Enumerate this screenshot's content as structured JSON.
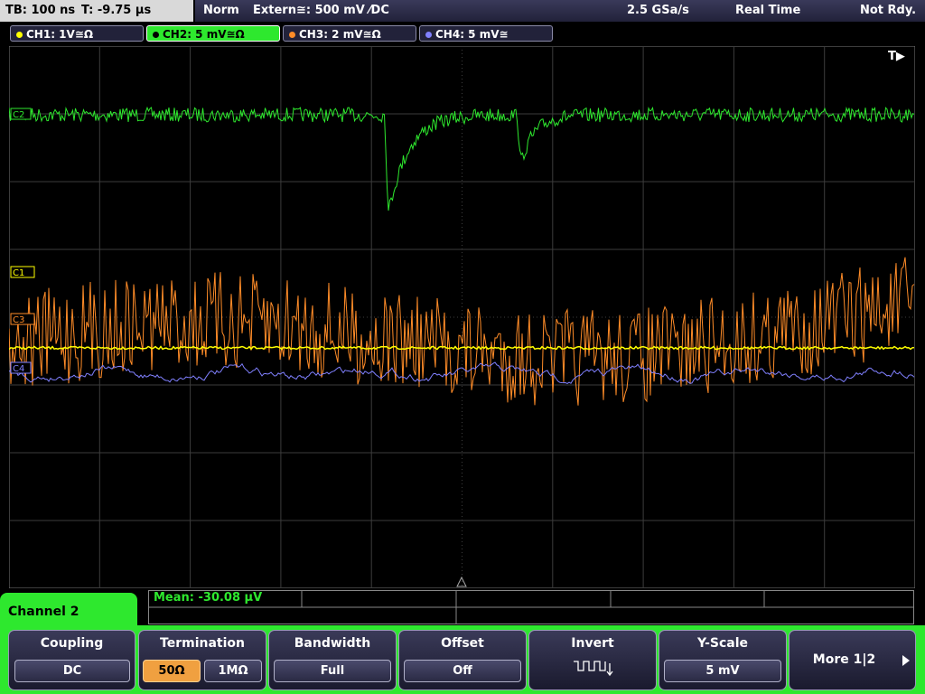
{
  "top": {
    "timebase": "TB: 100 ns",
    "trigger_time": "T: -9.75 µs",
    "mode": "Norm",
    "trigger_source": "Extern≅: 500 mV ⁄DC",
    "sample_rate": "2.5 GSa/s",
    "acq_mode": "Real Time",
    "status": "Not Rdy."
  },
  "channels": [
    {
      "label": "CH1: 1V≅Ω",
      "color": "#ffff00",
      "active": false
    },
    {
      "label": "CH2: 5 mV≅Ω",
      "color": "#2ee82e",
      "active": true
    },
    {
      "label": "CH3: 2 mV≅Ω",
      "color": "#ff8c28",
      "active": false
    },
    {
      "label": "CH4: 5 mV≅",
      "color": "#8080ff",
      "active": false
    }
  ],
  "screen": {
    "trigger_marker": "T▶",
    "ref_markers": {
      "ch2": "C2",
      "ch1": "C1",
      "ch3": "C3",
      "ch4": "C4"
    },
    "colors": {
      "grid": "#3c3c3c",
      "ch1": "#ffff00",
      "ch2": "#2ee82e",
      "ch3": "#ff8c28",
      "ch4": "#8080ff"
    }
  },
  "measurement": {
    "label": "Mean: -30.08 µV"
  },
  "menu": {
    "title": "Channel 2",
    "coupling": {
      "title": "Coupling",
      "value": "DC"
    },
    "termination": {
      "title": "Termination",
      "opt1": "50Ω",
      "opt2": "1MΩ",
      "selected": "50Ω"
    },
    "bandwidth": {
      "title": "Bandwidth",
      "value": "Full"
    },
    "offset": {
      "title": "Offset",
      "value": "Off"
    },
    "invert": {
      "title": "Invert",
      "icon": "inverted-square-wave-icon"
    },
    "yscale": {
      "title": "Y-Scale",
      "value": "5 mV"
    },
    "more": {
      "label": "More 1|2",
      "icon": "arrow-right-icon"
    }
  }
}
